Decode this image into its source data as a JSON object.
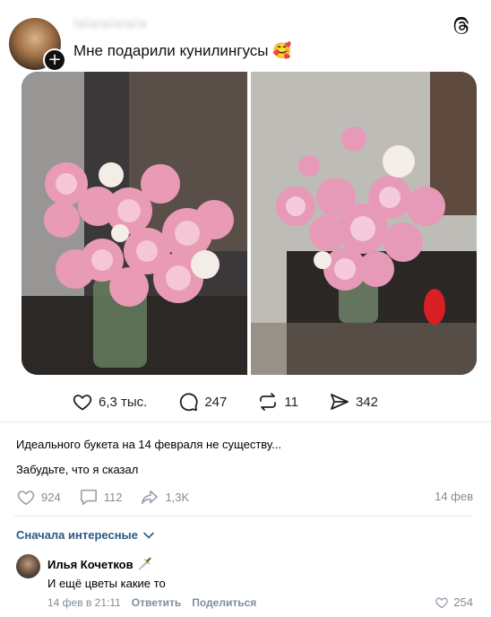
{
  "threads_post": {
    "username": "lalalalalala",
    "text": "Мне подарили кунилингусы",
    "text_emoji": "🥰",
    "actions": {
      "likes": "6,3 тыс.",
      "comments": "247",
      "reposts": "11",
      "shares": "342"
    }
  },
  "vk_post": {
    "line1": "Идеального букета на 14 февраля не существу...",
    "line2": "Забудьте, что я сказал",
    "stats": {
      "likes": "924",
      "comments": "112",
      "reposts": "1,3K"
    },
    "date": "14 фев",
    "sort_label": "Сначала интересные",
    "comment": {
      "author": "Илья Кочетков",
      "author_emoji": "🗡️",
      "text": "И ещё цветы какие то",
      "date": "14 фев в 21:11",
      "reply_label": "Ответить",
      "share_label": "Поделиться",
      "likes": "254"
    }
  },
  "colors": {
    "vk_link": "#2a5885",
    "vk_muted": "#818c99",
    "divider": "#e7e8ec"
  }
}
